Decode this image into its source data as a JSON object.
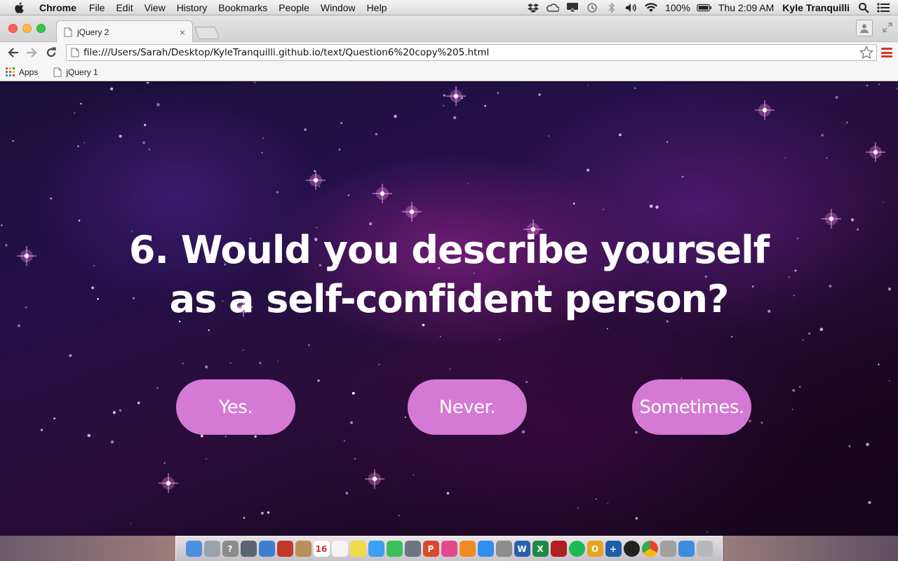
{
  "menubar": {
    "app": "Chrome",
    "items": [
      "File",
      "Edit",
      "View",
      "History",
      "Bookmarks",
      "People",
      "Window",
      "Help"
    ],
    "battery": "100%",
    "clock": "Thu 2:09 AM",
    "user": "Kyle Tranquilli",
    "status_icons": [
      "dropbox-icon",
      "creative-cloud-icon",
      "airplay-icon",
      "time-machine-icon",
      "bluetooth-icon",
      "volume-icon",
      "wifi-icon",
      "battery-icon",
      "spotlight-icon",
      "notification-center-icon"
    ]
  },
  "browser": {
    "tab_title": "jQuery 2",
    "url": "file:///Users/Sarah/Desktop/KyleTranquilli.github.io/text/Question6%20copy%205.html",
    "bookmarks": [
      "Apps",
      "jQuery 1"
    ]
  },
  "page": {
    "question": "6. Would you describe yourself as a self-confident person?",
    "answers": [
      "Yes.",
      "Never.",
      "Sometimes."
    ],
    "colors": {
      "button": "#d47ad4",
      "text": "#ffffff"
    }
  },
  "dock": {
    "apps": [
      "finder-icon",
      "launchpad-icon",
      "help-icon",
      "activity-monitor-icon",
      "preview-icon",
      "photo-booth-icon",
      "contacts-icon",
      "calendar-icon",
      "textedit-icon",
      "stickies-icon",
      "messages-icon",
      "facetime-icon",
      "image-capture-icon",
      "powerpoint-icon",
      "itunes-icon",
      "ibooks-icon",
      "app-store-icon",
      "system-preferences-icon",
      "word-icon",
      "excel-icon",
      "filezilla-icon",
      "spotify-icon",
      "outlook-icon",
      "textwrangler-icon",
      "github-icon",
      "chrome-icon",
      "documents-icon",
      "downloads-icon",
      "trash-icon"
    ]
  }
}
